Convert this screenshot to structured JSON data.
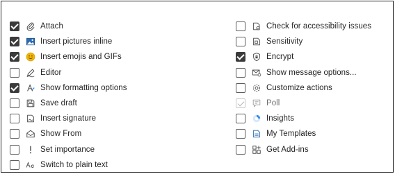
{
  "left_items": [
    {
      "label": "Attach",
      "checked": true,
      "icon": "paperclip-icon"
    },
    {
      "label": "Insert pictures inline",
      "checked": true,
      "icon": "picture-icon"
    },
    {
      "label": "Insert emojis and GIFs",
      "checked": true,
      "icon": "emoji-icon"
    },
    {
      "label": "Editor",
      "checked": false,
      "icon": "editor-pen-icon"
    },
    {
      "label": "Show formatting options",
      "checked": true,
      "icon": "formatting-icon"
    },
    {
      "label": "Save draft",
      "checked": false,
      "icon": "save-icon"
    },
    {
      "label": "Insert signature",
      "checked": false,
      "icon": "signature-icon"
    },
    {
      "label": "Show From",
      "checked": false,
      "icon": "show-from-icon"
    },
    {
      "label": "Set importance",
      "checked": false,
      "icon": "importance-icon"
    },
    {
      "label": "Switch to plain text",
      "checked": false,
      "icon": "plain-text-icon"
    }
  ],
  "right_items": [
    {
      "label": "Check for accessibility issues",
      "checked": false,
      "icon": "accessibility-icon"
    },
    {
      "label": "Sensitivity",
      "checked": false,
      "icon": "sensitivity-icon"
    },
    {
      "label": "Encrypt",
      "checked": true,
      "icon": "encrypt-shield-icon"
    },
    {
      "label": "Show message options...",
      "checked": false,
      "icon": "message-options-icon"
    },
    {
      "label": "Customize actions",
      "checked": false,
      "icon": "gear-icon"
    },
    {
      "label": "Poll",
      "checked": true,
      "disabled": true,
      "icon": "poll-icon"
    },
    {
      "label": "Insights",
      "checked": false,
      "icon": "insights-icon"
    },
    {
      "label": "My Templates",
      "checked": false,
      "icon": "templates-icon"
    },
    {
      "label": "Get Add-ins",
      "checked": false,
      "icon": "add-ins-icon"
    }
  ],
  "colors": {
    "checkbox_checked": "#3b3b3b",
    "text": "#242424",
    "emoji": "#f2b600",
    "picture_blue": "#2b6cb0",
    "insights_blue": "#3a8ee6"
  }
}
